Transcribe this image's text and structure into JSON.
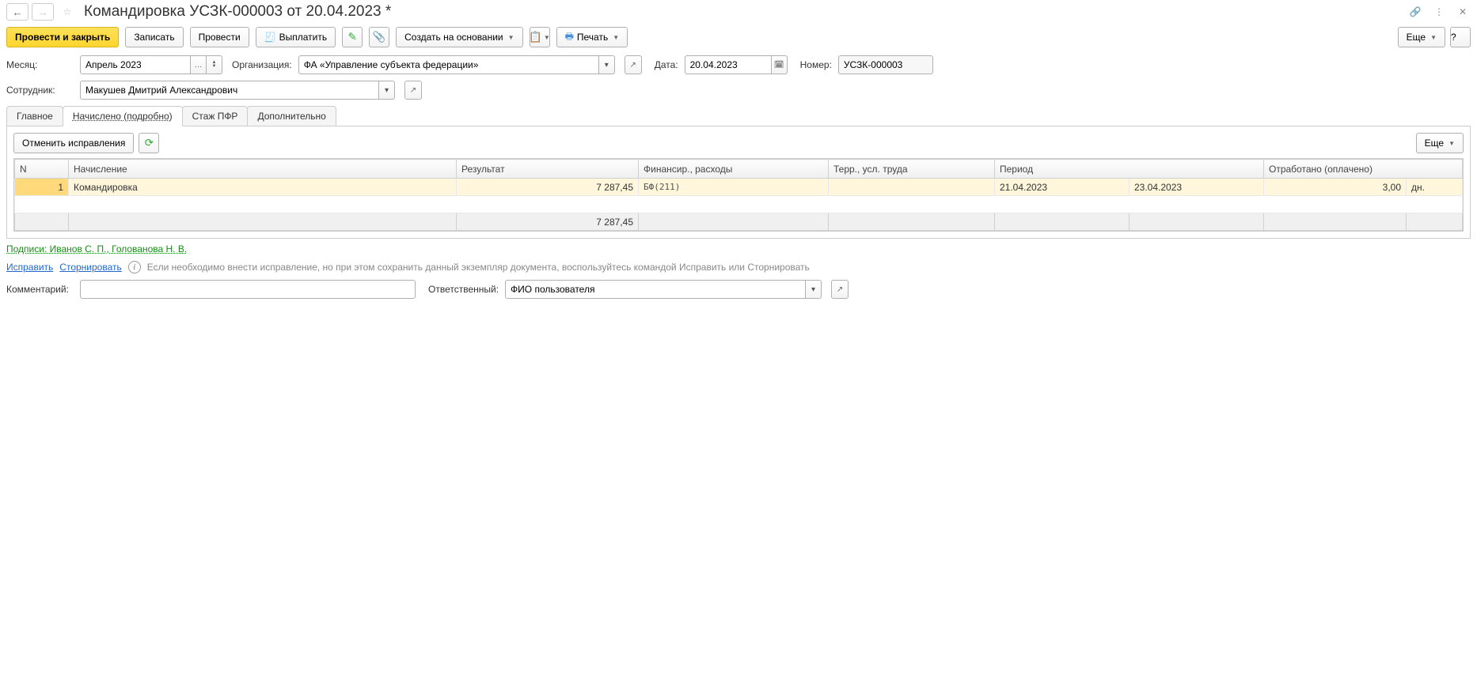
{
  "header": {
    "title": "Командировка УСЗК-000003 от 20.04.2023 *"
  },
  "toolbar": {
    "post_close": "Провести и закрыть",
    "save": "Записать",
    "post": "Провести",
    "pay": "Выплатить",
    "create_on_basis": "Создать на основании",
    "print": "Печать",
    "more": "Еще",
    "help": "?"
  },
  "form": {
    "month_label": "Месяц:",
    "month_value": "Апрель 2023",
    "org_label": "Организация:",
    "org_value": "ФА «Управление субъекта федерации»",
    "date_label": "Дата:",
    "date_value": "20.04.2023",
    "number_label": "Номер:",
    "number_value": "УСЗК-000003",
    "employee_label": "Сотрудник:",
    "employee_value": "Макушев Дмитрий Александрович"
  },
  "tabs": {
    "main": "Главное",
    "accrued": "Начислено (подробно)",
    "pfr": "Стаж ПФР",
    "extra": "Дополнительно"
  },
  "panel": {
    "cancel_corrections": "Отменить исправления",
    "more": "Еще"
  },
  "table": {
    "headers": {
      "n": "N",
      "accrual": "Начисление",
      "result": "Результат",
      "financing": "Финансир., расходы",
      "territory": "Терр., усл. труда",
      "period": "Период",
      "period2": "",
      "worked": "Отработано (оплачено)",
      "unit": ""
    },
    "row": {
      "n": "1",
      "accrual": "Командировка",
      "result": "7 287,45",
      "financing": "БФ(211)",
      "territory": "",
      "period_from": "21.04.2023",
      "period_to": "23.04.2023",
      "worked": "3,00",
      "unit": "дн."
    },
    "footer_result": "7 287,45"
  },
  "footer": {
    "signatures": "Подписи: Иванов С. П., Голованова Н. В.",
    "correct": "Исправить",
    "reverse": "Сторнировать",
    "info": "Если необходимо внести исправление, но при этом сохранить данный экземпляр документа, воспользуйтесь командой Исправить или Сторнировать",
    "comment_label": "Комментарий:",
    "responsible_label": "Ответственный:",
    "responsible_value": "ФИО пользователя"
  }
}
